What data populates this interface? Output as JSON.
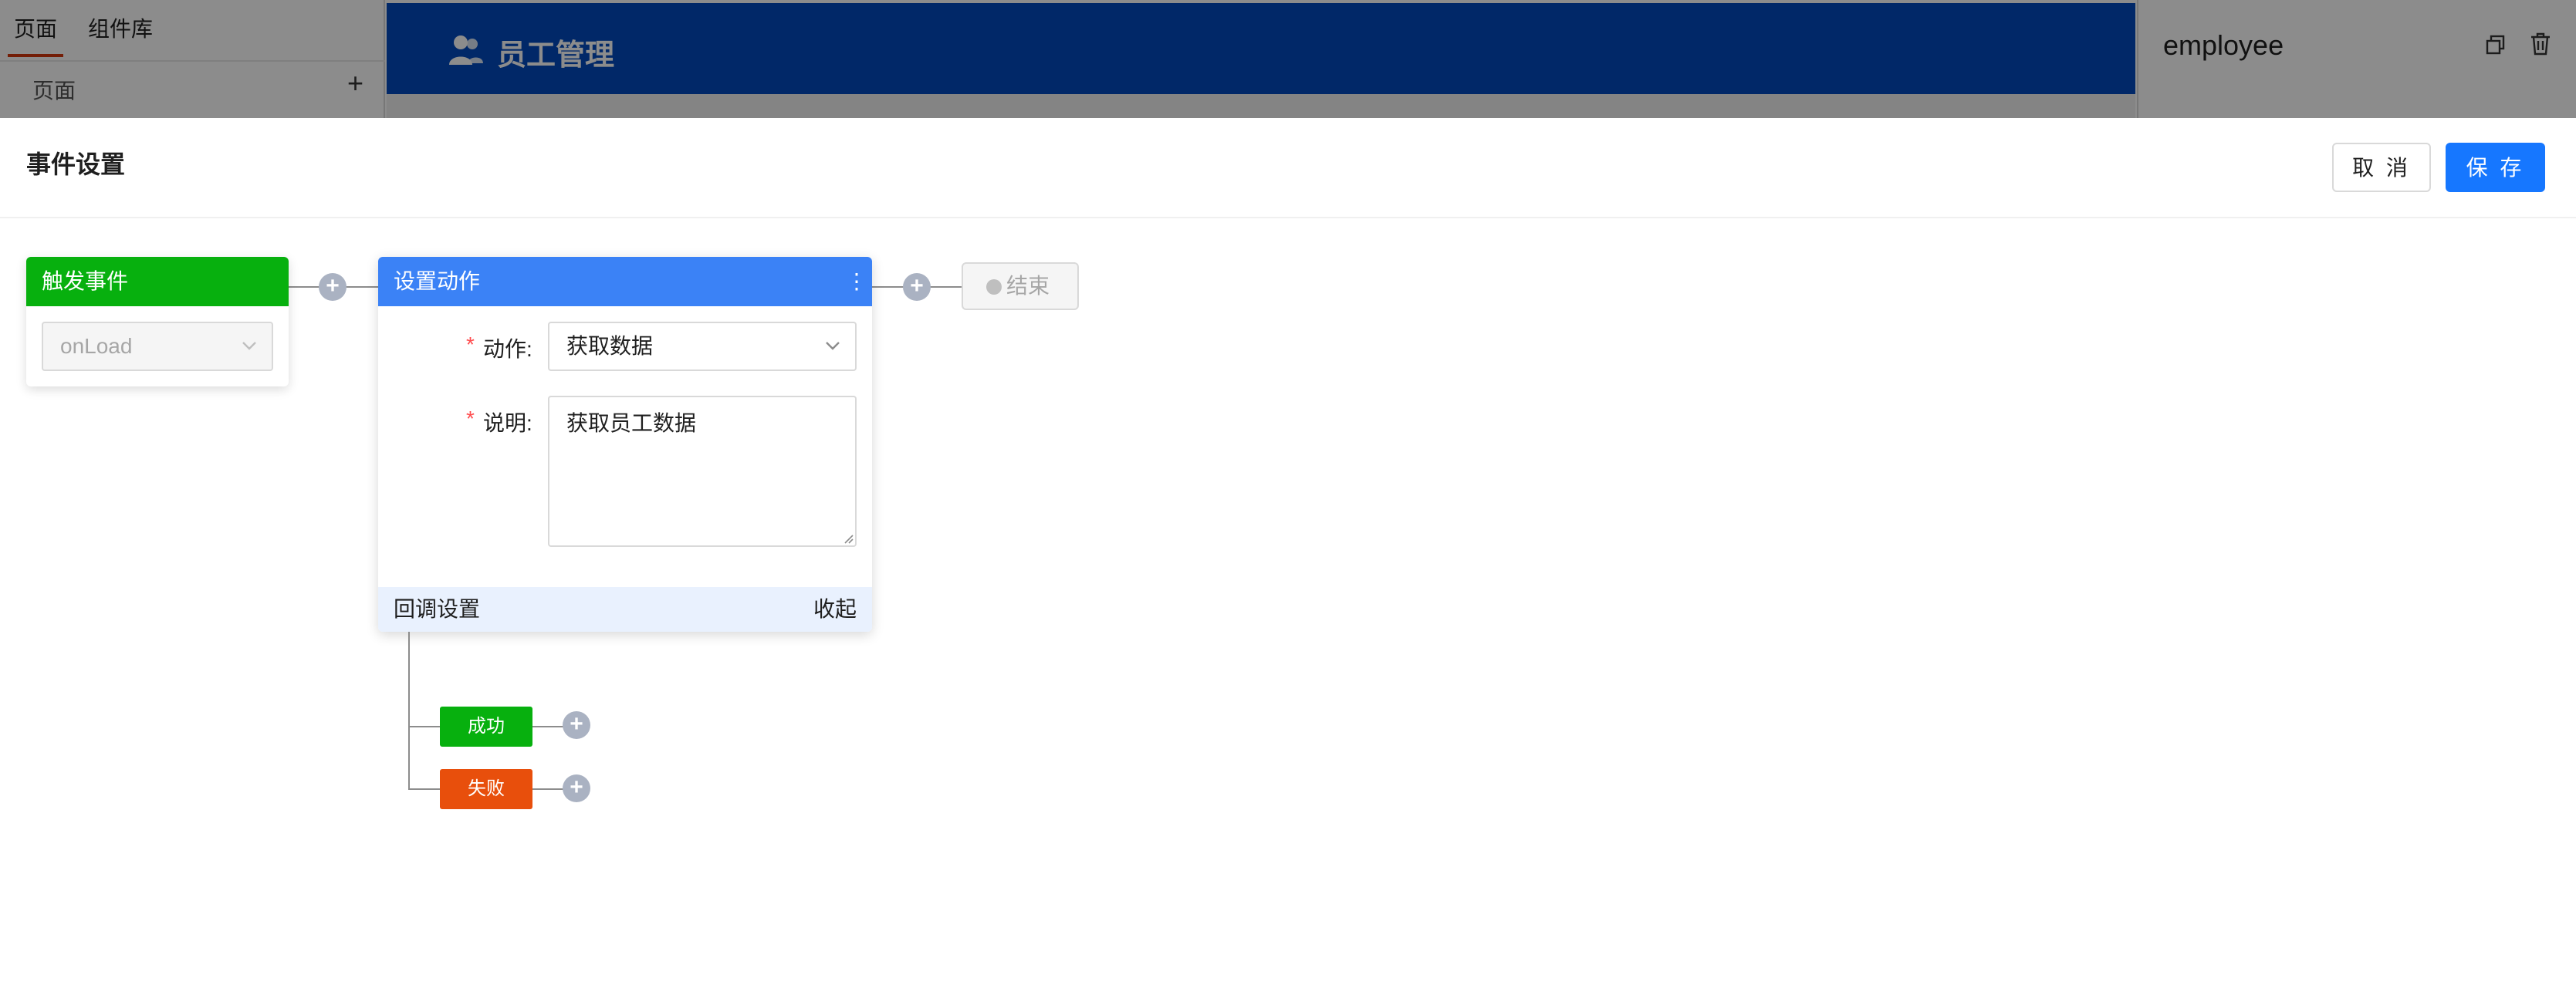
{
  "background": {
    "left_panel": {
      "tabs": [
        "页面",
        "组件库"
      ],
      "section_label": "页面",
      "add_symbol": "+"
    },
    "canvas_header": {
      "title": "员工管理",
      "color": "#0349be"
    },
    "right_panel": {
      "component_name": "employee"
    }
  },
  "drawer": {
    "title": "事件设置",
    "cancel_label": "取 消",
    "save_label": "保 存",
    "accent_color": "#1677ff"
  },
  "flow": {
    "plus_symbol": "+",
    "trigger": {
      "header": "触发事件",
      "selected_event": "onLoad",
      "color": "#07b00e"
    },
    "action": {
      "header": "设置动作",
      "more_symbol": "⋮",
      "required_mark": "*",
      "action_label": "动作:",
      "action_value": "获取数据",
      "desc_label": "说明:",
      "desc_value": "获取员工数据",
      "callback_label": "回调设置",
      "collapse_label": "收起",
      "color": "#3b82f6"
    },
    "end": {
      "label": "结束"
    },
    "callbacks": {
      "success_label": "成功",
      "fail_label": "失败",
      "success_color": "#07b00e",
      "fail_color": "#e84f0c"
    }
  }
}
